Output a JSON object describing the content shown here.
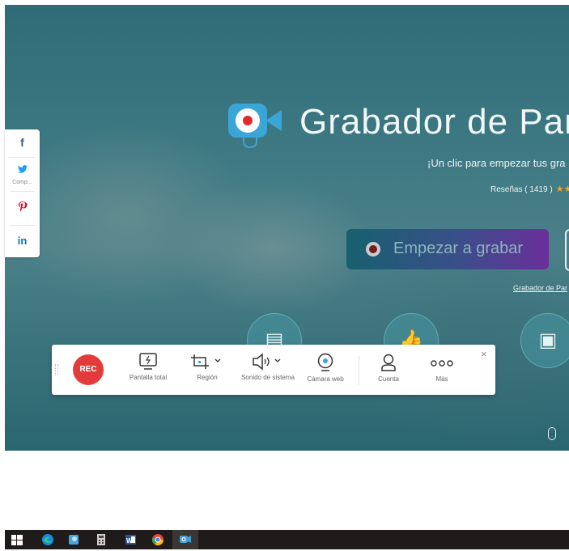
{
  "hero": {
    "title": "Grabador de Par",
    "subtitle": "¡Un clic para empezar tus gra",
    "reviews": "Reseñas ( 1419 )",
    "start_button": "Empezar a grabar",
    "small_link": "Grabador de Par"
  },
  "social": {
    "items": [
      {
        "icon": "facebook-icon",
        "glyph": "f"
      },
      {
        "icon": "twitter-icon",
        "glyph": "🐦",
        "label": "Comp..."
      },
      {
        "icon": "pinterest-icon",
        "glyph": "P"
      },
      {
        "icon": "linkedin-icon",
        "glyph": "in"
      }
    ]
  },
  "toolbar": {
    "rec_label": "REC",
    "items": [
      {
        "label": "Pantalla total",
        "icon": "monitor-icon"
      },
      {
        "label": "Región",
        "icon": "crop-icon"
      },
      {
        "label": "Sonido de sistema",
        "icon": "speaker-icon"
      },
      {
        "label": "Cámara web",
        "icon": "webcam-icon"
      },
      {
        "label": "Cuenta",
        "icon": "user-icon"
      },
      {
        "label": "Más",
        "icon": "more-icon"
      }
    ],
    "close": "×"
  },
  "taskbar": {
    "apps": [
      "windows-start-icon",
      "edge-icon",
      "photos-icon",
      "calculator-icon",
      "word-icon",
      "chrome-icon",
      "screen-recorder-icon"
    ]
  },
  "colors": {
    "accent": "#3aa6d8",
    "rec": "#e33b3b",
    "button_gradient_start": "#17606e",
    "button_gradient_end": "#6a2f9a"
  }
}
